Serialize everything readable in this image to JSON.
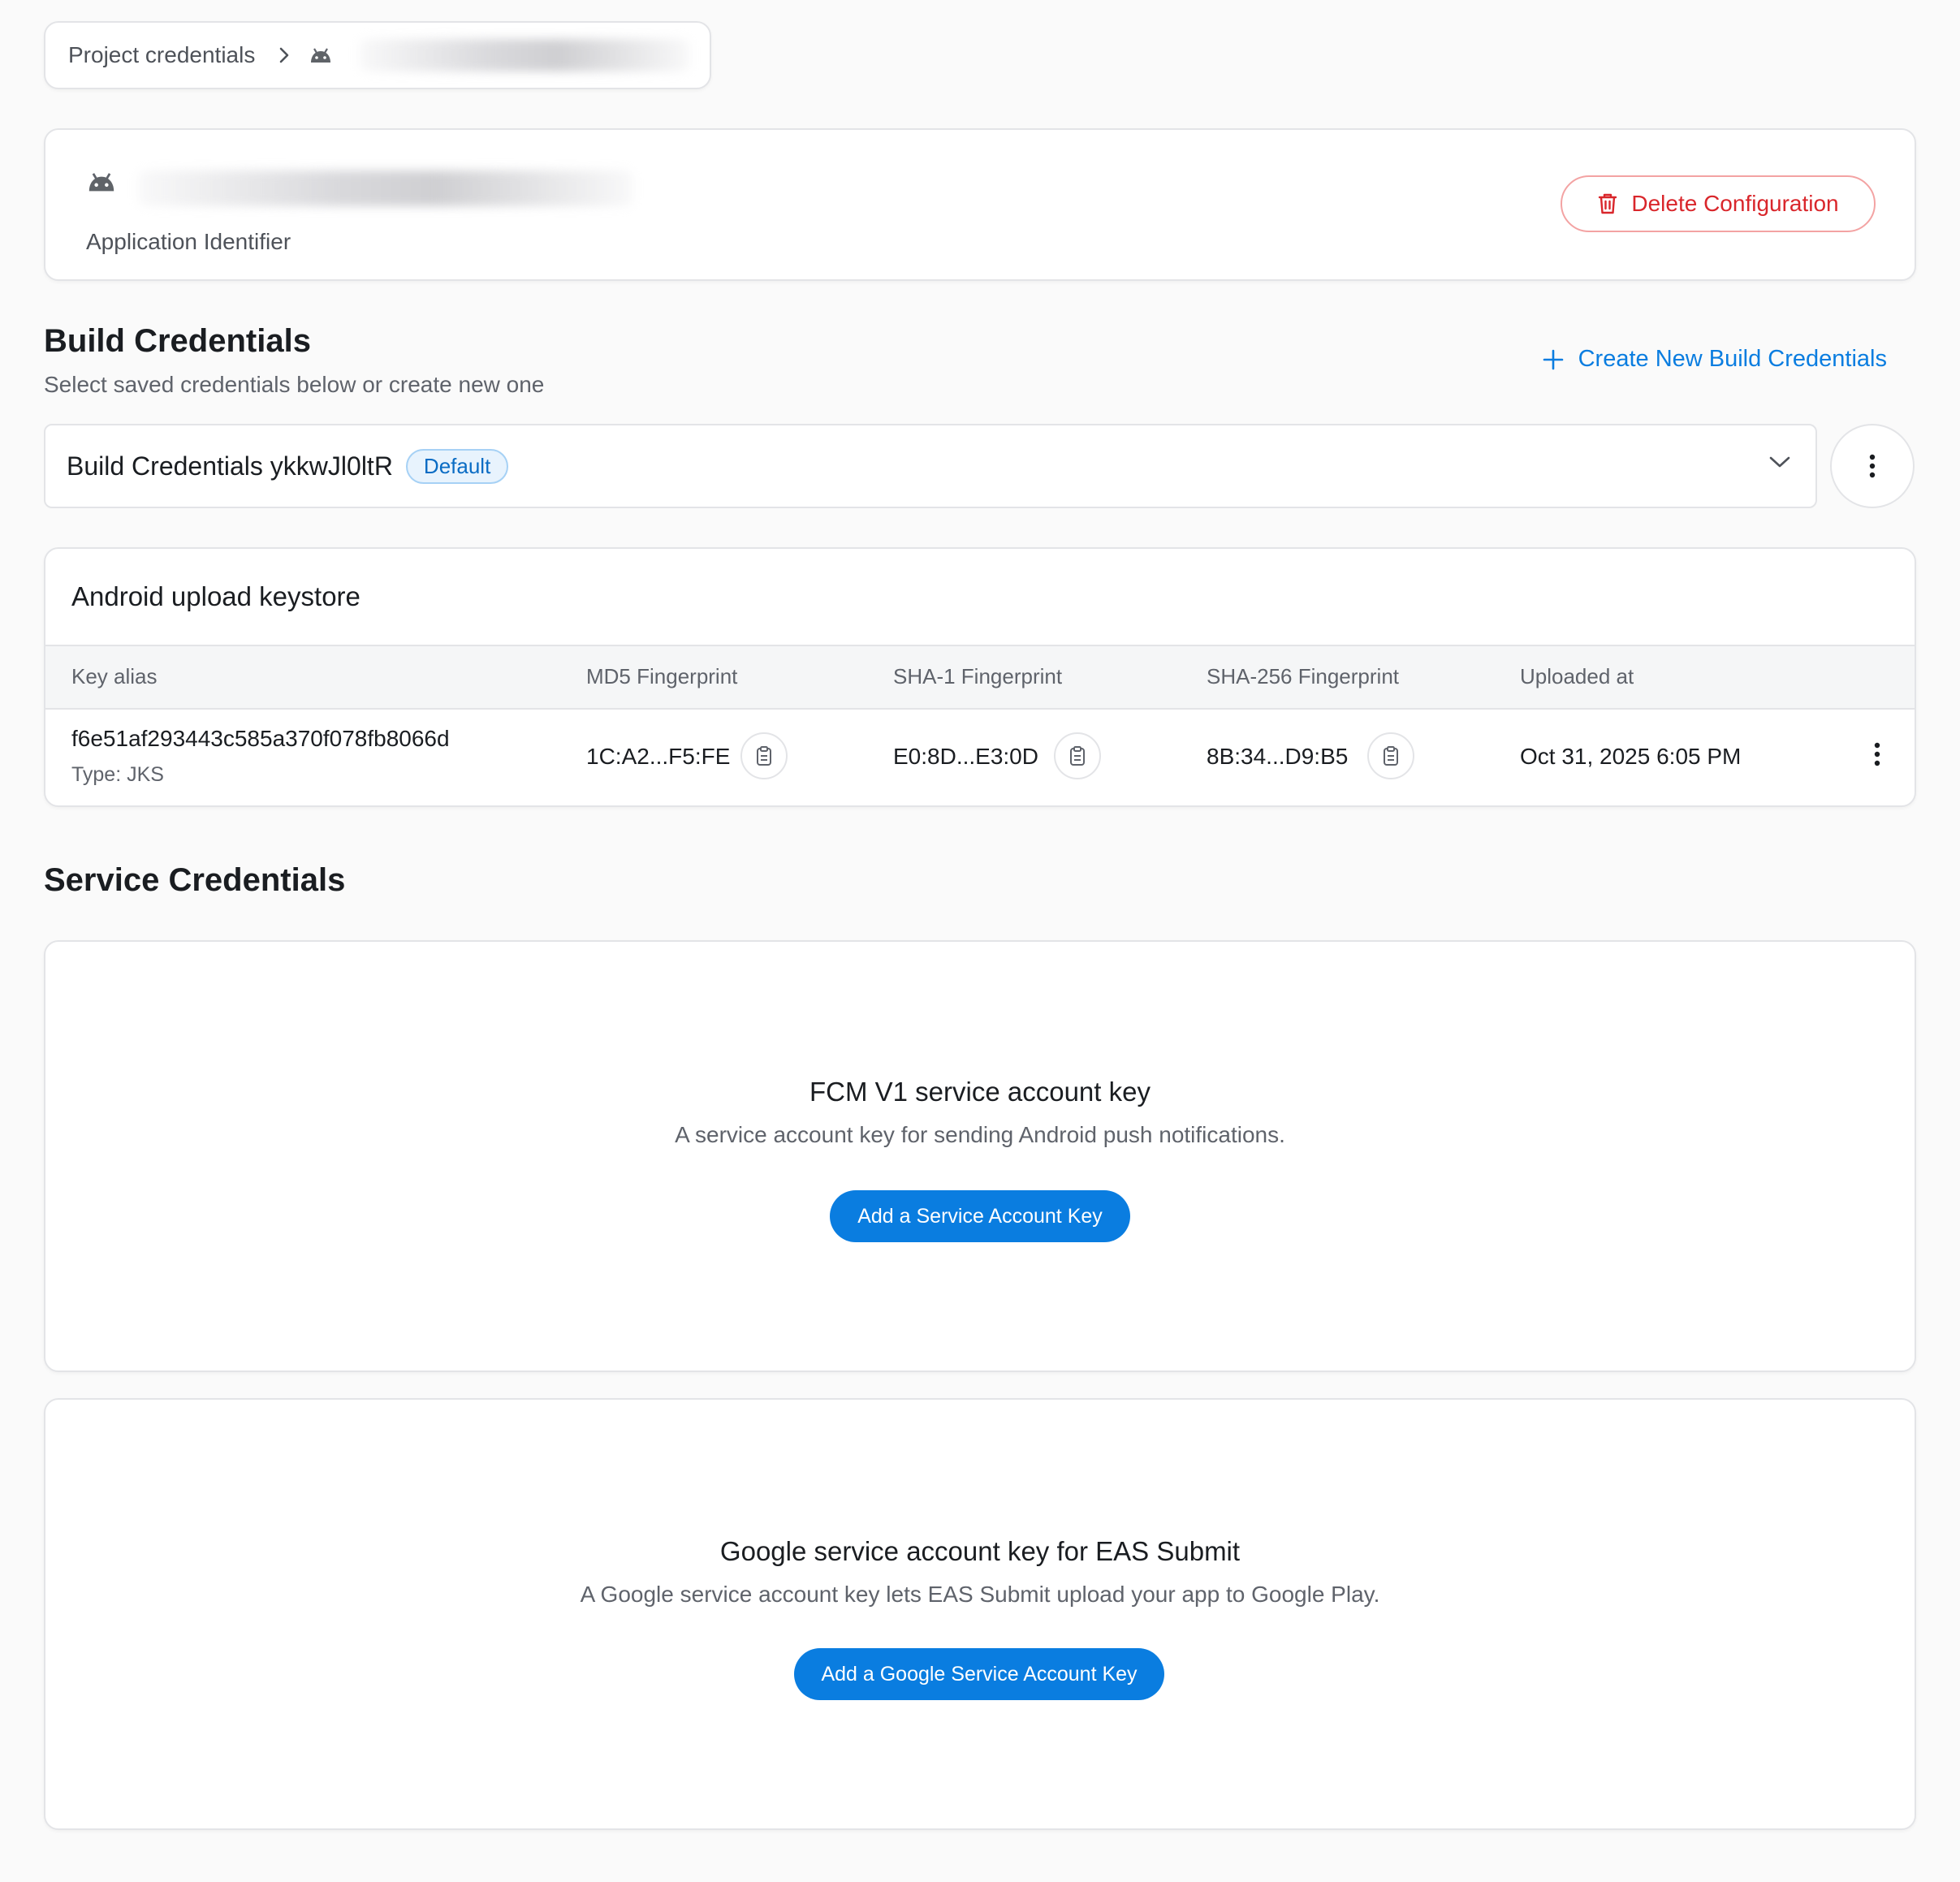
{
  "breadcrumb": {
    "root_label": "Project credentials",
    "platform_icon": "android-icon"
  },
  "app": {
    "identifier_label": "Application Identifier",
    "delete_label": "Delete Configuration"
  },
  "build": {
    "title": "Build Credentials",
    "subtitle": "Select saved credentials below or create new one",
    "create_label": "Create New Build Credentials",
    "selected": "Build Credentials ykkwJl0ltR",
    "badge": "Default"
  },
  "keystore": {
    "title": "Android upload keystore",
    "columns": [
      "Key alias",
      "MD5 Fingerprint",
      "SHA-1 Fingerprint",
      "SHA-256 Fingerprint",
      "Uploaded at"
    ],
    "row": {
      "alias": "f6e51af293443c585a370f078fb8066d",
      "type": "Type: JKS",
      "md5": "1C:A2...F5:FE",
      "sha1": "E0:8D...E3:0D",
      "sha256": "8B:34...D9:B5",
      "uploaded": "Oct 31, 2025 6:05 PM"
    }
  },
  "service": {
    "title": "Service Credentials",
    "fcm": {
      "title": "FCM V1 service account key",
      "desc": "A service account key for sending Android push notifications.",
      "button": "Add a Service Account Key"
    },
    "google": {
      "title": "Google service account key for EAS Submit",
      "desc": "A Google service account key lets EAS Submit upload your app to Google Play.",
      "button": "Add a Google Service Account Key"
    }
  },
  "colors": {
    "accent": "#0a7de0",
    "danger": "#d9262b",
    "background": "#fafafa"
  }
}
